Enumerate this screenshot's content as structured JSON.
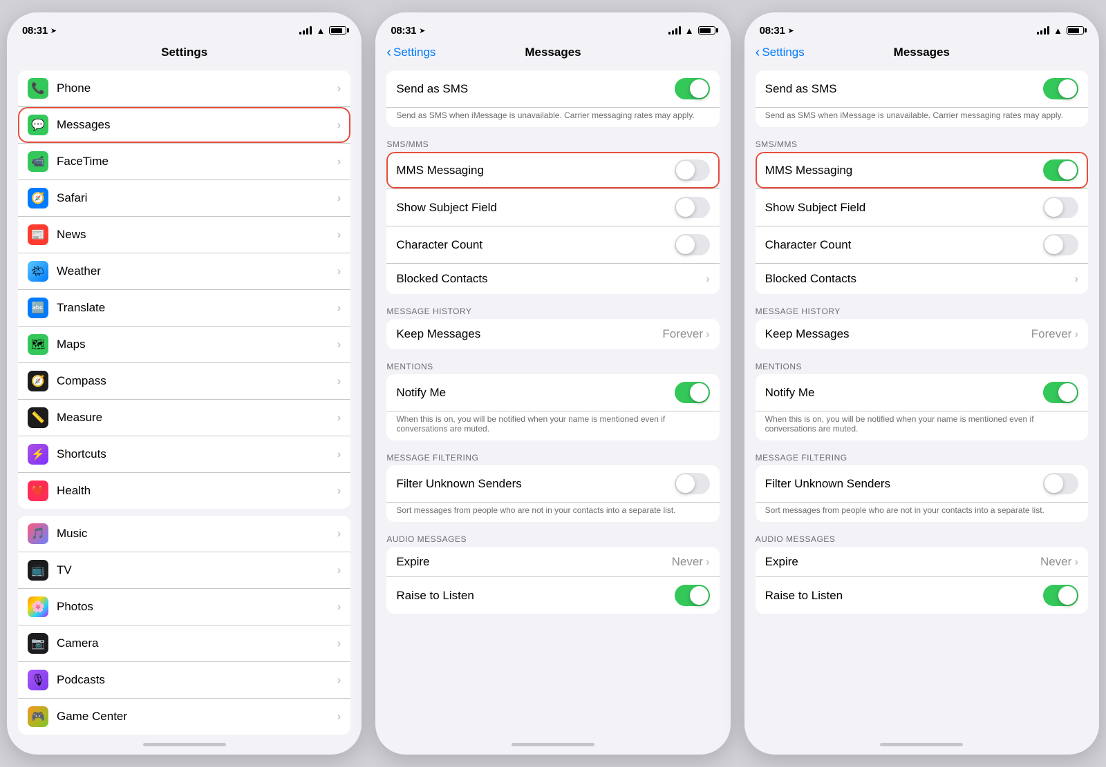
{
  "phone1": {
    "statusBar": {
      "time": "08:31",
      "hasLocation": true
    },
    "navTitle": "Settings",
    "topItems": [
      {
        "label": "Phone",
        "iconBg": "#34c759",
        "iconChar": "📞",
        "hasChevron": true
      },
      {
        "label": "Messages",
        "iconBg": "#34c759",
        "iconChar": "💬",
        "hasChevron": true,
        "highlighted": true
      },
      {
        "label": "FaceTime",
        "iconBg": "#34c759",
        "iconChar": "📹",
        "hasChevron": true
      },
      {
        "label": "Safari",
        "iconBg": "#007aff",
        "iconChar": "🧭",
        "hasChevron": true
      },
      {
        "label": "News",
        "iconBg": "#ff3b30",
        "iconChar": "📰",
        "hasChevron": true
      },
      {
        "label": "Weather",
        "iconBg": "#5ac8fa",
        "iconChar": "🌤",
        "hasChevron": true
      },
      {
        "label": "Translate",
        "iconBg": "#007aff",
        "iconChar": "🔤",
        "hasChevron": true
      },
      {
        "label": "Maps",
        "iconBg": "#34c759",
        "iconChar": "🗺",
        "hasChevron": true
      },
      {
        "label": "Compass",
        "iconBg": "#1c1c1e",
        "iconChar": "🧭",
        "hasChevron": true
      },
      {
        "label": "Measure",
        "iconBg": "#1c1c1e",
        "iconChar": "📏",
        "hasChevron": true
      },
      {
        "label": "Shortcuts",
        "iconBg": "#af52de",
        "iconChar": "⚡",
        "hasChevron": true
      },
      {
        "label": "Health",
        "iconBg": "#ff2d55",
        "iconChar": "❤️",
        "hasChevron": true
      }
    ],
    "bottomItems": [
      {
        "label": "Music",
        "iconBg": "gradient-music",
        "iconChar": "🎵",
        "hasChevron": true
      },
      {
        "label": "TV",
        "iconBg": "#1c1c1e",
        "iconChar": "📺",
        "hasChevron": true
      },
      {
        "label": "Photos",
        "iconBg": "gradient-photos",
        "iconChar": "🖼",
        "hasChevron": true
      },
      {
        "label": "Camera",
        "iconBg": "#1c1c1e",
        "iconChar": "📷",
        "hasChevron": true
      },
      {
        "label": "Podcasts",
        "iconBg": "gradient-podcasts",
        "iconChar": "🎙",
        "hasChevron": true
      },
      {
        "label": "Game Center",
        "iconBg": "gradient-gamecenter",
        "iconChar": "🎮",
        "hasChevron": true
      }
    ]
  },
  "phone2": {
    "statusBar": {
      "time": "08:31",
      "hasLocation": true
    },
    "navBack": "Settings",
    "navTitle": "Messages",
    "topSection": {
      "sendAsSMS": {
        "label": "Send as SMS",
        "on": true
      },
      "subtext": "Send as SMS when iMessage is unavailable. Carrier messaging rates may apply."
    },
    "smsMmsSection": {
      "label": "SMS/MMS",
      "mmsMessaging": {
        "label": "MMS Messaging",
        "on": false,
        "highlighted": true
      },
      "showSubjectField": {
        "label": "Show Subject Field",
        "on": false
      },
      "characterCount": {
        "label": "Character Count",
        "on": false
      },
      "blockedContacts": {
        "label": "Blocked Contacts",
        "hasChevron": true
      }
    },
    "messageHistorySection": {
      "label": "MESSAGE HISTORY",
      "keepMessages": {
        "label": "Keep Messages",
        "value": "Forever",
        "hasChevron": true
      }
    },
    "mentionsSection": {
      "label": "MENTIONS",
      "notifyMe": {
        "label": "Notify Me",
        "on": true
      },
      "subtext": "When this is on, you will be notified when your name is mentioned even if conversations are muted."
    },
    "messageFilteringSection": {
      "label": "MESSAGE FILTERING",
      "filterUnknownSenders": {
        "label": "Filter Unknown Senders",
        "on": false
      },
      "subtext": "Sort messages from people who are not in your contacts into a separate list."
    },
    "audioMessagesSection": {
      "label": "AUDIO MESSAGES",
      "expire": {
        "label": "Expire",
        "value": "Never",
        "hasChevron": true
      },
      "raiseToListen": {
        "label": "Raise to Listen",
        "on": true
      }
    }
  },
  "phone3": {
    "statusBar": {
      "time": "08:31",
      "hasLocation": true
    },
    "navBack": "Settings",
    "navTitle": "Messages",
    "topSection": {
      "sendAsSMS": {
        "label": "Send as SMS",
        "on": true
      },
      "subtext": "Send as SMS when iMessage is unavailable. Carrier messaging rates may apply."
    },
    "smsMmsSection": {
      "label": "SMS/MMS",
      "mmsMessaging": {
        "label": "MMS Messaging",
        "on": true,
        "highlighted": true
      },
      "showSubjectField": {
        "label": "Show Subject Field",
        "on": false
      },
      "characterCount": {
        "label": "Character Count",
        "on": false
      },
      "blockedContacts": {
        "label": "Blocked Contacts",
        "hasChevron": true
      }
    },
    "messageHistorySection": {
      "label": "MESSAGE HISTORY",
      "keepMessages": {
        "label": "Keep Messages",
        "value": "Forever",
        "hasChevron": true
      }
    },
    "mentionsSection": {
      "label": "MENTIONS",
      "notifyMe": {
        "label": "Notify Me",
        "on": true
      },
      "subtext": "When this is on, you will be notified when your name is mentioned even if conversations are muted."
    },
    "messageFilteringSection": {
      "label": "MESSAGE FILTERING",
      "filterUnknownSenders": {
        "label": "Filter Unknown Senders",
        "on": false
      },
      "subtext": "Sort messages from people who are not in your contacts into a separate list."
    },
    "audioMessagesSection": {
      "label": "AUDIO MESSAGES",
      "expire": {
        "label": "Expire",
        "value": "Never",
        "hasChevron": true
      },
      "raiseToListen": {
        "label": "Raise to Listen",
        "on": true
      }
    }
  }
}
